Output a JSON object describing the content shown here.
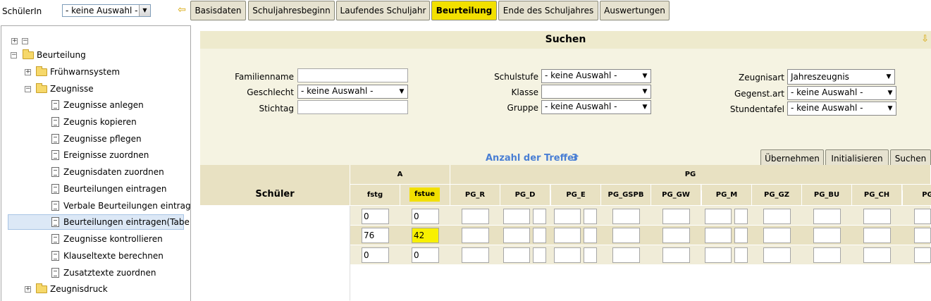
{
  "topbar": {
    "student_label": "SchülerIn",
    "student_select": "- keine Auswahl -",
    "tabs": [
      {
        "label": "Basisdaten"
      },
      {
        "label": "Schuljahresbeginn"
      },
      {
        "label": "Laufendes Schuljahr"
      },
      {
        "label": "Beurteilung",
        "active": true
      },
      {
        "label": "Ende des Schuljahres"
      },
      {
        "label": "Auswertungen"
      }
    ]
  },
  "sidebar": {
    "items": [
      {
        "label": "Beurteilung",
        "icon": "folder-open-icon"
      },
      {
        "label": "Frühwarnsystem",
        "icon": "folder-icon"
      },
      {
        "label": "Zeugnisse",
        "icon": "folder-open-icon"
      },
      {
        "label": "Zeugnisse anlegen",
        "icon": "document-icon"
      },
      {
        "label": "Zeugnis kopieren",
        "icon": "document-icon"
      },
      {
        "label": "Zeugnisse pflegen",
        "icon": "document-icon"
      },
      {
        "label": "Ereignisse zuordnen",
        "icon": "document-icon"
      },
      {
        "label": "Zeugnisdaten zuordnen",
        "icon": "document-icon"
      },
      {
        "label": "Beurteilungen eintragen",
        "icon": "document-icon"
      },
      {
        "label": "Verbale Beurteilungen eintragen",
        "icon": "document-icon"
      },
      {
        "label": "Beurteilungen eintragen(Tabelle)",
        "icon": "document-icon",
        "selected": true
      },
      {
        "label": "Zeugnisse kontrollieren",
        "icon": "document-icon"
      },
      {
        "label": "Klauseltexte berechnen",
        "icon": "document-icon"
      },
      {
        "label": "Zusatztexte zuordnen",
        "icon": "document-icon"
      },
      {
        "label": "Zeugnisdruck",
        "icon": "folder-icon"
      }
    ]
  },
  "search": {
    "title": "Suchen",
    "familienname_label": "Familienname",
    "familienname_value": "",
    "geschlecht_label": "Geschlecht",
    "geschlecht_value": "- keine Auswahl -",
    "stichtag_label": "Stichtag",
    "stichtag_value": "",
    "schulstufe_label": "Schulstufe",
    "schulstufe_value": "- keine Auswahl -",
    "klasse_label": "Klasse",
    "klasse_value": "",
    "gruppe_label": "Gruppe",
    "gruppe_value": "- keine Auswahl -",
    "zeugnisart_label": "Zeugnisart",
    "zeugnisart_value": "Jahreszeugnis",
    "gegenstart_label": "Gegenst.art",
    "gegenstart_value": "- keine Auswahl -",
    "stundentafel_label": "Stundentafel",
    "stundentafel_value": "- keine Auswahl -",
    "hits_label": "Anzahl der Treffer",
    "hits_count": "3",
    "buttons": {
      "uebernehmen": "Übernehmen",
      "initialisieren": "Initialisieren",
      "suchen": "Suchen"
    }
  },
  "grid": {
    "student_header": "Schüler",
    "group_a": "A",
    "group_pg": "PG",
    "col_fstg": "fstg",
    "col_fstue": "fstue",
    "pg_columns": [
      "PG_R",
      "PG_D",
      "PG_E",
      "PG_GSPB",
      "PG_GW",
      "PG_M",
      "PG_GZ",
      "PG_BU",
      "PG_CH",
      "PG"
    ],
    "rows": [
      {
        "fstg": "0",
        "fstue": "0"
      },
      {
        "fstg": "76",
        "fstue": "42"
      },
      {
        "fstg": "0",
        "fstue": "0"
      }
    ]
  },
  "colors": {
    "active_tab": "#f2e000",
    "panel": "#f5f3e2",
    "hits_text": "#4a7fd4"
  }
}
